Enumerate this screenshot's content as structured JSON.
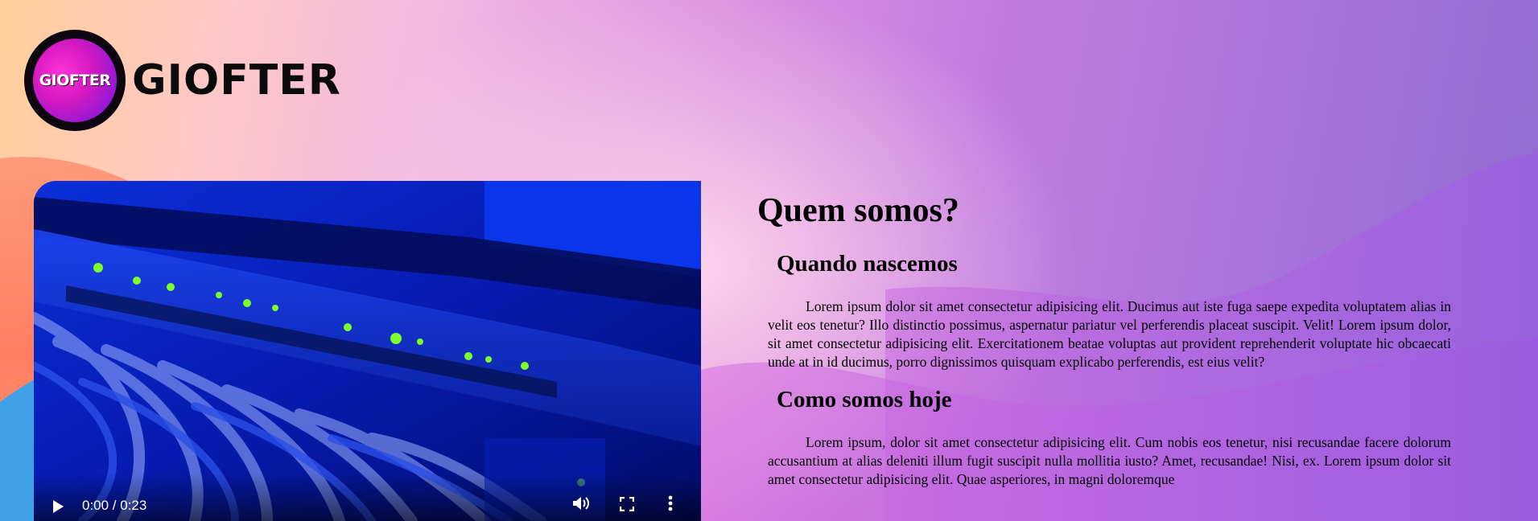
{
  "brand": {
    "badge_text": "GIOFTER",
    "wordmark": "GIOFTER"
  },
  "video": {
    "time": "0:00 / 0:23"
  },
  "about": {
    "title": "Quem somos?",
    "sections": [
      {
        "heading": "Quando nascemos",
        "text": "Lorem ipsum dolor sit amet consectetur adipisicing elit. Ducimus aut iste fuga saepe expedita voluptatem alias in velit eos tenetur? Illo distinctio possimus, aspernatur pariatur vel perferendis placeat suscipit. Velit! Lorem ipsum dolor, sit amet consectetur adipisicing elit. Exercitationem beatae voluptas aut provident reprehenderit voluptate hic obcaecati unde at in id ducimus, porro dignissimos quisquam explicabo perferendis, est eius velit?"
      },
      {
        "heading": "Como somos hoje",
        "text": "Lorem ipsum, dolor sit amet consectetur adipisicing elit. Cum nobis eos tenetur, nisi recusandae facere dolorum accusantium at alias deleniti illum fugit suscipit nulla mollitia iusto? Amet, recusandae! Nisi, ex. Lorem ipsum dolor sit amet consectetur adipisicing elit. Quae asperiores, in magni doloremque"
      }
    ]
  },
  "icons": {
    "logo": "giofter-logo-icon",
    "play": "play-icon",
    "volume": "volume-icon",
    "fullscreen": "fullscreen-icon",
    "more": "more-options-icon"
  },
  "colors": {
    "logo_magenta": "#e01fc9",
    "logo_purple": "#6b18e0",
    "video_blue": "#0a2ad8",
    "led_green": "#7dff2a"
  }
}
